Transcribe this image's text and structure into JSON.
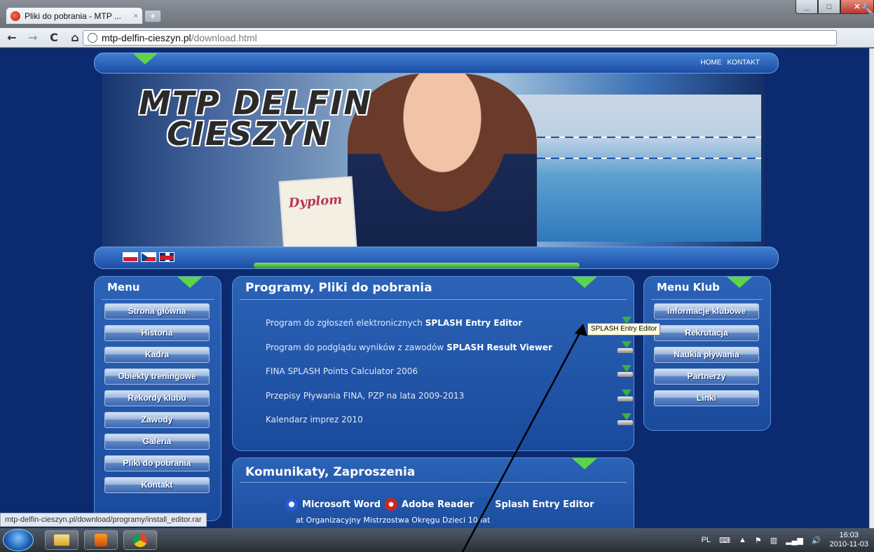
{
  "browser": {
    "tab_title": "Pliki do pobrania - MTP ...",
    "tab_close": "×",
    "new_tab": "+",
    "url_host": "mtp-delfin-cieszyn.pl",
    "url_path": "/download.html",
    "status_url": "mtp-delfin-cieszyn.pl/download/programy/install_editor.rar"
  },
  "site": {
    "topnav": [
      "HOME",
      "KONTAKT"
    ],
    "logo_line1": "MTP DELFIN",
    "logo_line2": "CIESZYN",
    "diploma_text": "Dyplom",
    "menu": {
      "title": "Menu",
      "items": [
        "Strona główna",
        "Historia",
        "Kadra",
        "Obiekty treningowe",
        "Rekordy klubu",
        "Zawody",
        "Galeria",
        "Pliki do pobrania",
        "Kontakt"
      ]
    },
    "downloads": {
      "title": "Programy, Pliki do pobrania",
      "items": [
        {
          "text": "Program do zgłoszeń elektronicznych",
          "bold": "SPLASH Entry Editor"
        },
        {
          "text": "Program do podglądu wyników z zawodów",
          "bold": "SPLASH Result Viewer"
        },
        {
          "text": "FINA SPLASH Points Calculator 2006",
          "bold": ""
        },
        {
          "text": "Przepisy Pływania FINA, PZP na lata 2009-2013",
          "bold": ""
        },
        {
          "text": "Kalendarz imprez 2010",
          "bold": ""
        }
      ],
      "tooltip": "SPLASH Entry Editor"
    },
    "menu_klub": {
      "title": "Menu Klub",
      "items": [
        "Informacje klubowe",
        "Rekrutacja",
        "Naukia pływania",
        "Partnerzy",
        "Linki"
      ]
    },
    "komunikaty": {
      "title": "Komunikaty, Zaproszenia",
      "apps": [
        "Microsoft Word",
        "Adobe Reader",
        "Splash Entry Editor"
      ],
      "item": "at Organizacyjny Mistrzostwa Okręgu Dzieci 10 lat"
    }
  },
  "taskbar": {
    "lang": "PL",
    "time": "16:03",
    "date": "2010-11-03"
  }
}
